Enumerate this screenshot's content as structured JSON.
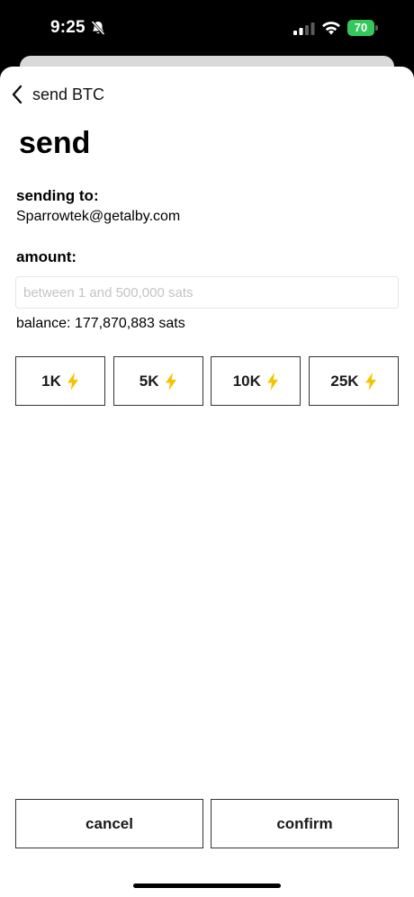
{
  "status_bar": {
    "time": "9:25",
    "battery_level": "70",
    "icons": [
      "bell-slash-icon",
      "signal-icon",
      "wifi-icon",
      "battery-charging-icon"
    ]
  },
  "nav": {
    "back_label": "send BTC",
    "back_icon": "chevron-left-icon"
  },
  "page": {
    "title": "send"
  },
  "recipient": {
    "label": "sending to:",
    "value": "Sparrowtek@getalby.com"
  },
  "amount": {
    "label": "amount:",
    "value": "",
    "placeholder": "between 1 and 500,000 sats"
  },
  "balance_text": "balance: 177,870,883 sats",
  "quick_amounts": [
    {
      "label": "1K",
      "icon": "lightning-bolt-icon"
    },
    {
      "label": "5K",
      "icon": "lightning-bolt-icon"
    },
    {
      "label": "10K",
      "icon": "lightning-bolt-icon"
    },
    {
      "label": "25K",
      "icon": "lightning-bolt-icon"
    }
  ],
  "actions": {
    "cancel_label": "cancel",
    "confirm_label": "confirm"
  },
  "colors": {
    "accent_bolt": "#f5c400",
    "battery": "#34c759",
    "button_border": "#333333"
  }
}
